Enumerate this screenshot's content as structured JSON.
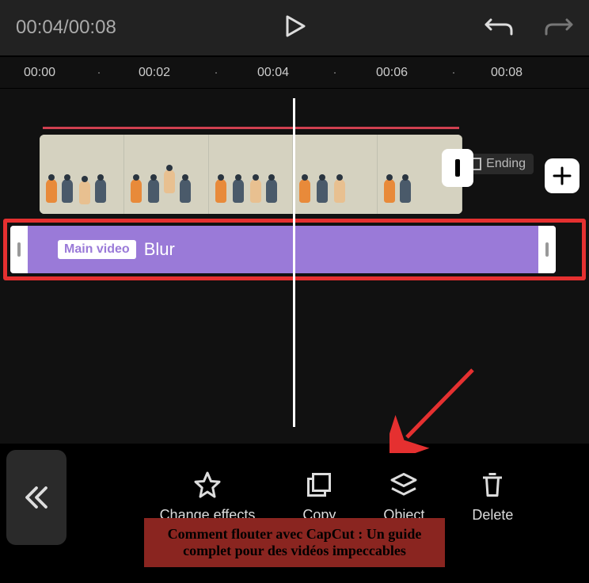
{
  "header": {
    "current_time": "00:04",
    "total_time": "00:08",
    "time_display": "00:04/00:08"
  },
  "ruler": {
    "labels": [
      "00:00",
      "00:02",
      "00:04",
      "00:06",
      "00:08"
    ]
  },
  "timeline": {
    "ending_label": "Ending",
    "add_label": "+"
  },
  "effect_track": {
    "badge": "Main video",
    "name": "Blur"
  },
  "toolbar": {
    "items": [
      {
        "label": "Change effects",
        "icon": "star-icon"
      },
      {
        "label": "Copy",
        "icon": "copy-icon"
      },
      {
        "label": "Object",
        "icon": "layers-icon"
      },
      {
        "label": "Delete",
        "icon": "trash-icon"
      }
    ]
  },
  "caption": "Comment flouter avec CapCut : Un guide complet pour des vidéos impeccables"
}
